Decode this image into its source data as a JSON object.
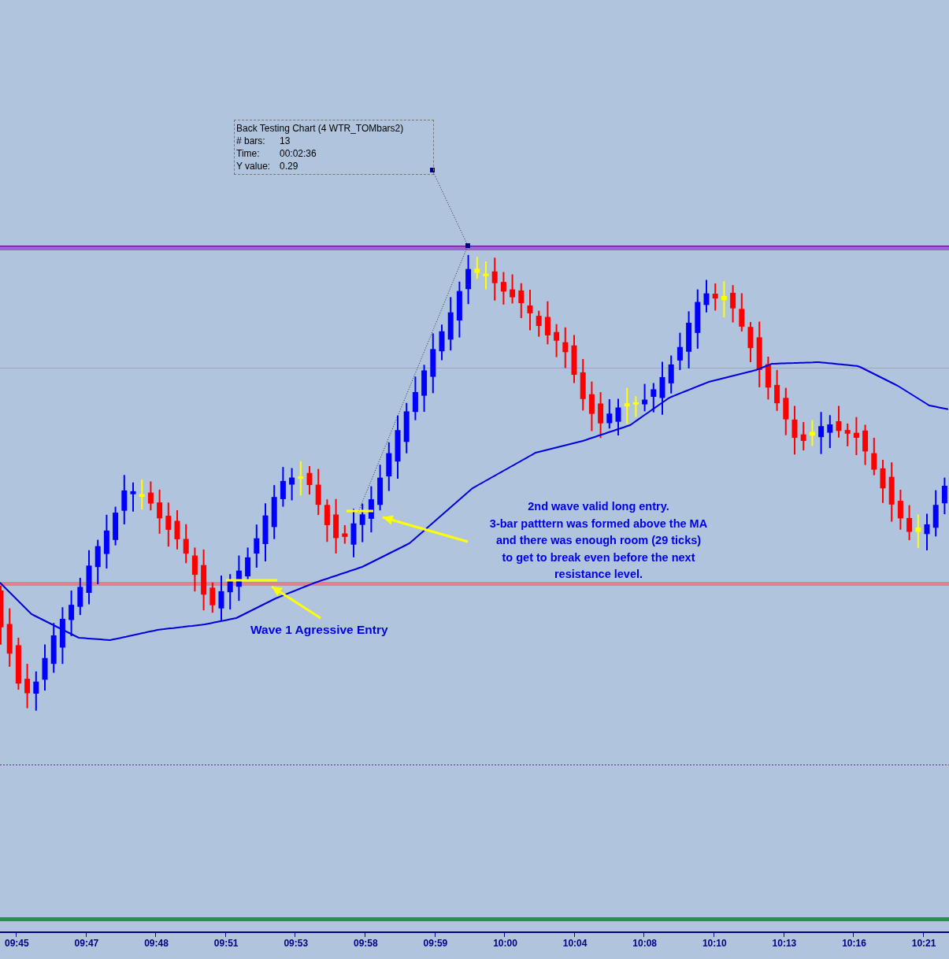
{
  "chart": {
    "tooltip": {
      "title": "Back Testing Chart (4 WTR_TOMbars2)",
      "rows": [
        {
          "label": "# bars:",
          "value": "13"
        },
        {
          "label": "Time:",
          "value": "00:02:36"
        },
        {
          "label": "Y value:",
          "value": "0.29"
        }
      ]
    },
    "annotations": [
      {
        "kind": "note",
        "text": "2nd wave valid long entry.\n3-bar patttern was formed above the MA\nand there was enough room (29 ticks)\nto get to break even before the next\nresistance level."
      },
      {
        "kind": "label",
        "text": "Wave 1 Agressive Entry"
      }
    ],
    "time_axis": {
      "labels": [
        "09:45",
        "09:47",
        "09:48",
        "09:51",
        "09:53",
        "09:58",
        "09:59",
        "10:00",
        "10:04",
        "10:08",
        "10:10",
        "10:13",
        "10:16",
        "10:21"
      ]
    }
  }
}
